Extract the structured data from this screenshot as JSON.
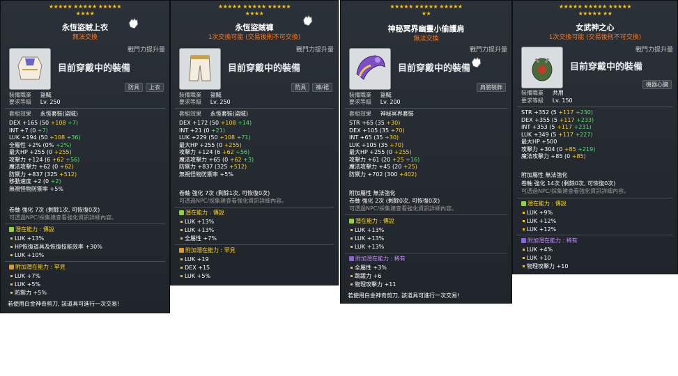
{
  "panels": [
    {
      "stars_line1": "★★★★★ ★★★★★ ★★★★★",
      "stars_line2": "★★★★",
      "title": "永恆盜賊上衣",
      "subtitle": "無法交換",
      "growth_label": "戰鬥力提升量",
      "equipped_label": "目前穿戴中的裝備",
      "tags": [
        "防具",
        "上衣"
      ],
      "job_label": "裝備職業",
      "job_value": "盜賊",
      "level_label": "要求等級",
      "level_value": "Lv. 250",
      "set_label": "套組效果",
      "set_value": "永恆套裝(盜賊)",
      "stats": [
        {
          "name": "DEX",
          "base": "+165",
          "detail": "(50",
          "bonus": "+108",
          "extra": "+7)"
        },
        {
          "name": "INT",
          "base": "+7",
          "detail": "(0",
          "bonus": "",
          "extra": "+7)"
        },
        {
          "name": "LUK",
          "base": "+194",
          "detail": "(50",
          "bonus": "+108",
          "extra": "+36)"
        },
        {
          "name": "全屬性",
          "base": "+2%",
          "detail": "(0%",
          "bonus": "",
          "extra": "+2%)"
        },
        {
          "name": "最大HP",
          "base": "+255",
          "detail": "(0",
          "bonus": "+255)",
          "extra": ""
        },
        {
          "name": "攻擊力",
          "base": "+124",
          "detail": "(6",
          "bonus": "+62",
          "extra": "+56)"
        },
        {
          "name": "魔法攻擊力",
          "base": "+62",
          "detail": "(0",
          "bonus": "+62)",
          "extra": ""
        },
        {
          "name": "防禦力",
          "base": "+837",
          "detail": "(325",
          "bonus": "+512)",
          "extra": ""
        },
        {
          "name": "移動速度",
          "base": "+2",
          "detail": "(0",
          "bonus": "",
          "extra": "+2)"
        },
        {
          "name": "無視怪物防禦率",
          "base": "+5%",
          "detail": "",
          "bonus": "",
          "extra": ""
        }
      ],
      "scroll_line": "卷軸 強化 7次 (剩餘1次, 可恢復0次)",
      "scroll_note": "可透過NPC/採集建查看強化資訊詳細內容。",
      "pot_title": "潛在能力 : 傳說",
      "pot_lines": [
        "LUK +13%",
        "HP恢復道具及恢復技能效率 +30%",
        "LUK +10%"
      ],
      "add_title": "附加潛在能力 : 罕見",
      "add_lines": [
        "LUK +7%",
        "LUK +5%",
        "防禦力 +5%"
      ],
      "footer": "若使用白金神奇剪刀, 該道具可進行一次交易!"
    },
    {
      "stars_line1": "★★★★★ ★★★★★ ★★★★★",
      "stars_line2": "★★★★",
      "title": "永恆盜賊褲",
      "subtitle": "1次交換可能 (交易後則不可交換)",
      "growth_label": "戰鬥力提升量",
      "equipped_label": "目前穿戴中的裝備",
      "tags": [
        "防具",
        "褲/裙"
      ],
      "job_label": "裝備職業",
      "job_value": "盜賊",
      "level_label": "要求等級",
      "level_value": "Lv. 250",
      "set_label": "套組效果",
      "set_value": "永恆套裝(盜賊)",
      "stats": [
        {
          "name": "DEX",
          "base": "+172",
          "detail": "(50",
          "bonus": "+108",
          "extra": "+14)"
        },
        {
          "name": "INT",
          "base": "+21",
          "detail": "(0",
          "bonus": "",
          "extra": "+21)"
        },
        {
          "name": "LUK",
          "base": "+229",
          "detail": "(50",
          "bonus": "+108",
          "extra": "+71)"
        },
        {
          "name": "最大HP",
          "base": "+255",
          "detail": "(0",
          "bonus": "+255)",
          "extra": ""
        },
        {
          "name": "攻擊力",
          "base": "+124",
          "detail": "(6",
          "bonus": "+62",
          "extra": "+56)"
        },
        {
          "name": "魔法攻擊力",
          "base": "+65",
          "detail": "(0",
          "bonus": "+62",
          "extra": "+3)"
        },
        {
          "name": "防禦力",
          "base": "+837",
          "detail": "(325",
          "bonus": "+512)",
          "extra": ""
        },
        {
          "name": "無視怪物防禦率",
          "base": "+5%",
          "detail": "",
          "bonus": "",
          "extra": ""
        }
      ],
      "scroll_line": "卷軸 強化 7次 (剩餘1次, 可恢復0次)",
      "scroll_note": "可透過NPC/採集建查看強化資訊詳細內容。",
      "pot_title": "潛在能力 : 傳說",
      "pot_lines": [
        "LUK +13%",
        "LUK +13%",
        "全屬性 +7%"
      ],
      "add_title": "附加潛在能力 : 罕見",
      "add_lines": [
        "LUK +19",
        "DEX +15",
        "LUK +5%"
      ],
      "footer": ""
    },
    {
      "stars_line1": "★★★★★ ★★★★★ ★★★★★",
      "stars_line2": "★★",
      "title": "神秘冥界幽靈小偷護肩",
      "subtitle": "無法交換",
      "growth_label": "戰鬥力提升量",
      "equipped_label": "目前穿戴中的裝備",
      "tags": [
        "肩膀裝飾"
      ],
      "job_label": "裝備職業",
      "job_value": "盜賊",
      "level_label": "要求等級",
      "level_value": "Lv. 200",
      "set_label": "套組效果",
      "set_value": "神秘冥界套裝",
      "stats": [
        {
          "name": "STR",
          "base": "+65",
          "detail": "(35",
          "bonus": "+30)",
          "extra": ""
        },
        {
          "name": "DEX",
          "base": "+105",
          "detail": "(35",
          "bonus": "+70)",
          "extra": ""
        },
        {
          "name": "INT",
          "base": "+65",
          "detail": "(35",
          "bonus": "+30)",
          "extra": ""
        },
        {
          "name": "LUK",
          "base": "+105",
          "detail": "(35",
          "bonus": "+70)",
          "extra": ""
        },
        {
          "name": "最大HP",
          "base": "+255",
          "detail": "(0",
          "bonus": "+255)",
          "extra": ""
        },
        {
          "name": "攻擊力",
          "base": "+61",
          "detail": "(20",
          "bonus": "+25",
          "extra": "+16)"
        },
        {
          "name": "魔法攻擊力",
          "base": "+45",
          "detail": "(20",
          "bonus": "+25)",
          "extra": ""
        },
        {
          "name": "防禦力",
          "base": "+702",
          "detail": "(300",
          "bonus": "+402)",
          "extra": ""
        }
      ],
      "extra_line": "附加屬性 無法強化",
      "scroll_line": "卷軸 強化 2次 (剩餘0次, 可恢復0次)",
      "scroll_note": "可透過NPC/採集建查看強化資訊詳細內容。",
      "pot_title": "潛在能力 : 傳說",
      "pot_lines": [
        "LUK +13%",
        "LUK +13%",
        "LUK +13%"
      ],
      "add_title": "附加潛在能力 : 稀有",
      "add_lines": [
        "全屬性 +3%",
        "跳躍力 +6",
        "物理攻擊力 +11"
      ],
      "footer": "若使用白金神奇剪刀, 該道具可進行一次交易!"
    },
    {
      "stars_line1": "★★★★★ ★★★★★ ★★★★★",
      "stars_line2": "★★★★★ ★★",
      "title": "女武神之心",
      "subtitle": "1次交換可能 (交易後則不可交換)",
      "growth_label": "戰鬥力提升量",
      "equipped_label": "目前穿戴中的裝備",
      "tags": [
        "機器心臟"
      ],
      "job_label": "裝備職業",
      "job_value": "共用",
      "level_label": "要求等級",
      "level_value": "Lv. 150",
      "stats": [
        {
          "name": "STR",
          "base": "+352",
          "detail": "(5",
          "bonus": "+117",
          "extra": "+230)"
        },
        {
          "name": "DEX",
          "base": "+355",
          "detail": "(5",
          "bonus": "+117",
          "extra": "+233)"
        },
        {
          "name": "INT",
          "base": "+353",
          "detail": "(5",
          "bonus": "+117",
          "extra": "+231)"
        },
        {
          "name": "LUK",
          "base": "+349",
          "detail": "(5",
          "bonus": "+117",
          "extra": "+227)"
        },
        {
          "name": "最大HP",
          "base": "+500",
          "detail": "",
          "bonus": "",
          "extra": ""
        },
        {
          "name": "攻擊力",
          "base": "+304",
          "detail": "(0",
          "bonus": "+85",
          "extra": "+219)"
        },
        {
          "name": "魔法攻擊力",
          "base": "+85",
          "detail": "(0",
          "bonus": "+85)",
          "extra": ""
        }
      ],
      "extra_line": "附加屬性 無法強化",
      "scroll_line": "卷軸 強化 14次 (剩餘0次, 可恢復0次)",
      "scroll_note": "可透過NPC/採集建查看強化資訊詳細內容。",
      "pot_title": "潛在能力 : 傳說",
      "pot_lines": [
        "LUK +9%",
        "LUK +12%",
        "LUK +12%"
      ],
      "add_title": "附加潛在能力 : 稀有",
      "add_lines": [
        "LUK +4%",
        "LUK +10",
        "物理攻擊力 +10"
      ],
      "footer": ""
    }
  ]
}
